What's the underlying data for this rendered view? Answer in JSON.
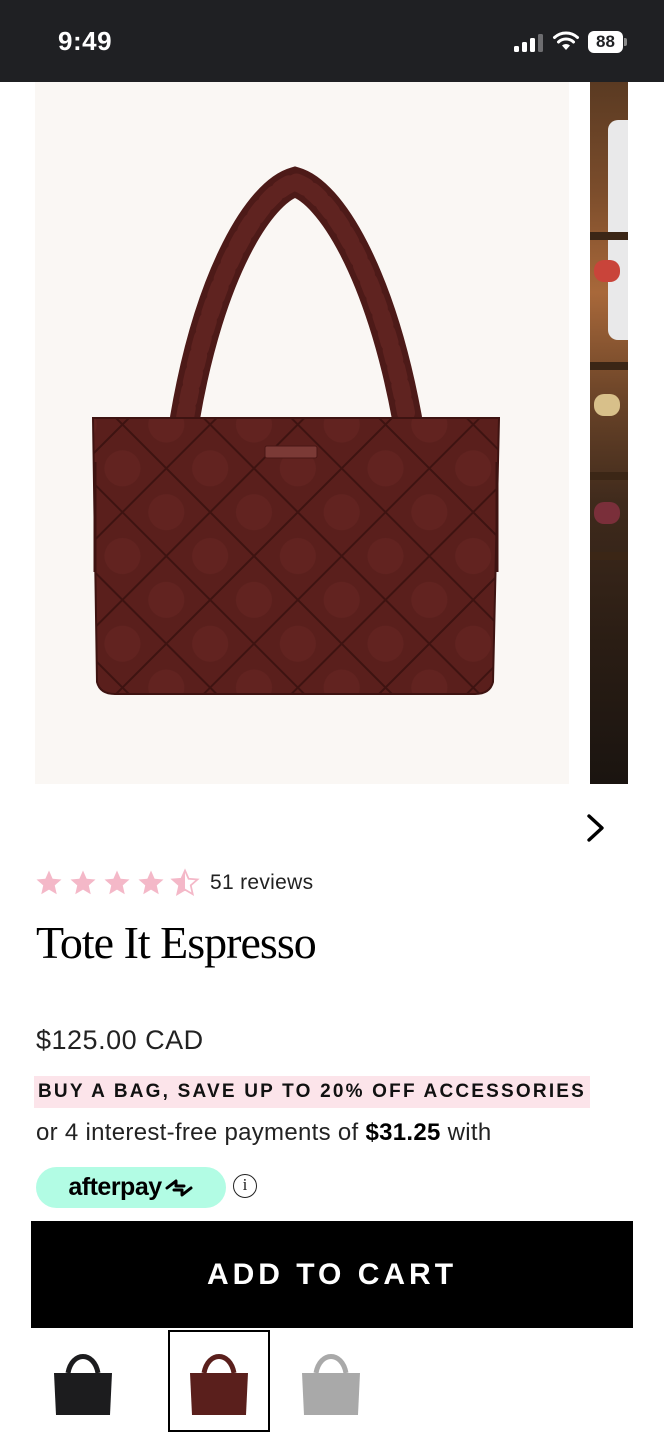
{
  "status_bar": {
    "time": "9:49",
    "battery": "88",
    "icons": [
      "cellular-signal-icon",
      "wifi-icon",
      "battery-icon"
    ]
  },
  "gallery": {
    "current_image": "Tote It Espresso quilted tote bag",
    "next_arrow_icon": "chevron-right-icon"
  },
  "product": {
    "rating": 4.5,
    "reviews_label": "51 reviews",
    "title": "Tote It Espresso",
    "price": "$125.00 CAD",
    "promo": "BUY A BAG, SAVE UP TO 20% OFF ACCESSORIES",
    "installments_prefix": "or 4 interest-free payments of ",
    "installment_amount": "$31.25",
    "installments_suffix": " with",
    "afterpay_label": "afterpay",
    "info_icon_glyph": "i"
  },
  "actions": {
    "add_to_cart": "ADD TO CART"
  },
  "swatches": [
    {
      "color": "#1c1c1e",
      "selected": false
    },
    {
      "color": "#5a1f1c",
      "selected": true
    },
    {
      "color": "#a9a9a9",
      "selected": false
    }
  ],
  "colors": {
    "star": "#f4b8c8",
    "promo_bg": "#fce4ea",
    "afterpay_bg": "#b2fce4",
    "bag": "#5a1f1c",
    "cta_bg": "#000000"
  }
}
